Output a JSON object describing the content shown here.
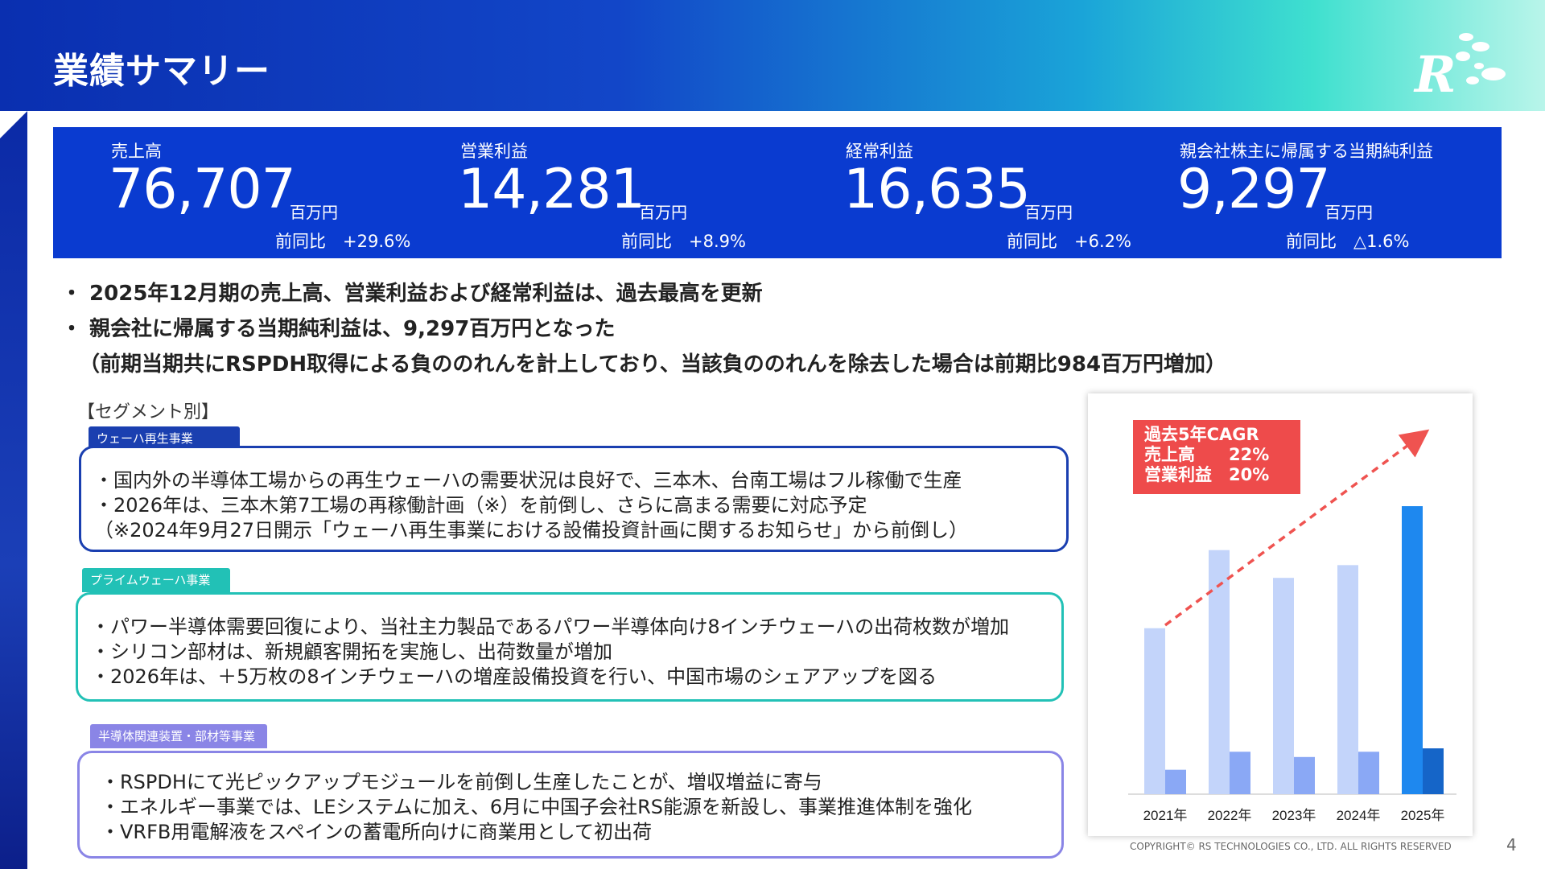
{
  "header": {
    "title": "業績サマリー",
    "logo_text": "R"
  },
  "kpis": [
    {
      "label": "売上高",
      "value": "76,707",
      "unit": "百万円",
      "yoy": "前同比　+29.6%"
    },
    {
      "label": "営業利益",
      "value": "14,281",
      "unit": "百万円",
      "yoy": "前同比　+8.9%"
    },
    {
      "label": "経常利益",
      "value": "16,635",
      "unit": "百万円",
      "yoy": "前同比　+6.2%"
    },
    {
      "label": "親会社株主に帰属する当期純利益",
      "value": "9,297",
      "unit": "百万円",
      "yoy": "前同比　△1.6%"
    }
  ],
  "summary": {
    "b1": "・ 2025年12月期の売上高、営業利益および経常利益は、過去最高を更新",
    "b2": "・ 親会社に帰属する当期純利益は、9,297百万円となった",
    "b3": "（前期当期共にRSPDH取得による負ののれんを計上しており、当該負ののれんを除去した場合は前期比984百万円増加）"
  },
  "segments": {
    "heading": "【セグメント別】",
    "items": [
      {
        "tag": "ウェーハ再生事業",
        "color": "#1a3fb0",
        "lines": [
          "・国内外の半導体工場からの再生ウェーハの需要状況は良好で、三本木、台南工場はフル稼働で生産",
          "・2026年は、三本木第7工場の再稼働計画（※）を前倒し、さらに高まる需要に対応予定",
          "（※2024年9月27日開示「ウェーハ再生事業における設備投資計画に関するお知らせ」から前倒し）"
        ]
      },
      {
        "tag": "プライムウェーハ事業",
        "color": "#22c1b6",
        "lines": [
          "・パワー半導体需要回復により、当社主力製品であるパワー半導体向け8インチウェーハの出荷枚数が増加",
          "・シリコン部材は、新規顧客開拓を実施し、出荷数量が増加",
          "・2026年は、＋5万枚の8インチウェーハの増産設備投資を行い、中国市場のシェアアップを図る"
        ]
      },
      {
        "tag": "半導体関連装置・部材等事業",
        "color": "#8a85e6",
        "lines": [
          "・RSPDHにて光ピックアップモジュールを前倒し生産したことが、増収増益に寄与",
          "・エネルギー事業では、LEシステムに加え、6月に中国子会社RS能源を新設し、事業推進体制を強化",
          "・VRFB用電解液をスペインの蓄電所向けに商業用として初出荷"
        ]
      }
    ]
  },
  "cagr": {
    "title": "過去5年CAGR",
    "row1": "売上高　　22%",
    "row2": "営業利益　20%"
  },
  "chart_data": {
    "type": "bar",
    "categories": [
      "2021年",
      "2022年",
      "2023年",
      "2024年",
      "2025年"
    ],
    "series": [
      {
        "values": [
          44.2,
          65.0,
          57.6,
          61.0,
          76.7
        ]
      },
      {
        "values": [
          6.5,
          11.3,
          9.9,
          11.3,
          12.2
        ]
      }
    ],
    "ylim": [
      0,
      90
    ],
    "colors": {
      "light": "#c3d4fa",
      "dark": "#8aa8f5",
      "light_last": "#1e88ef",
      "dark_last": "#1565c8"
    },
    "trend_color": "#ef5350"
  },
  "footer": {
    "copyright": "COPYRIGHT© RS TECHNOLOGIES CO., LTD. ALL RIGHTS RESERVED",
    "page": "4"
  }
}
